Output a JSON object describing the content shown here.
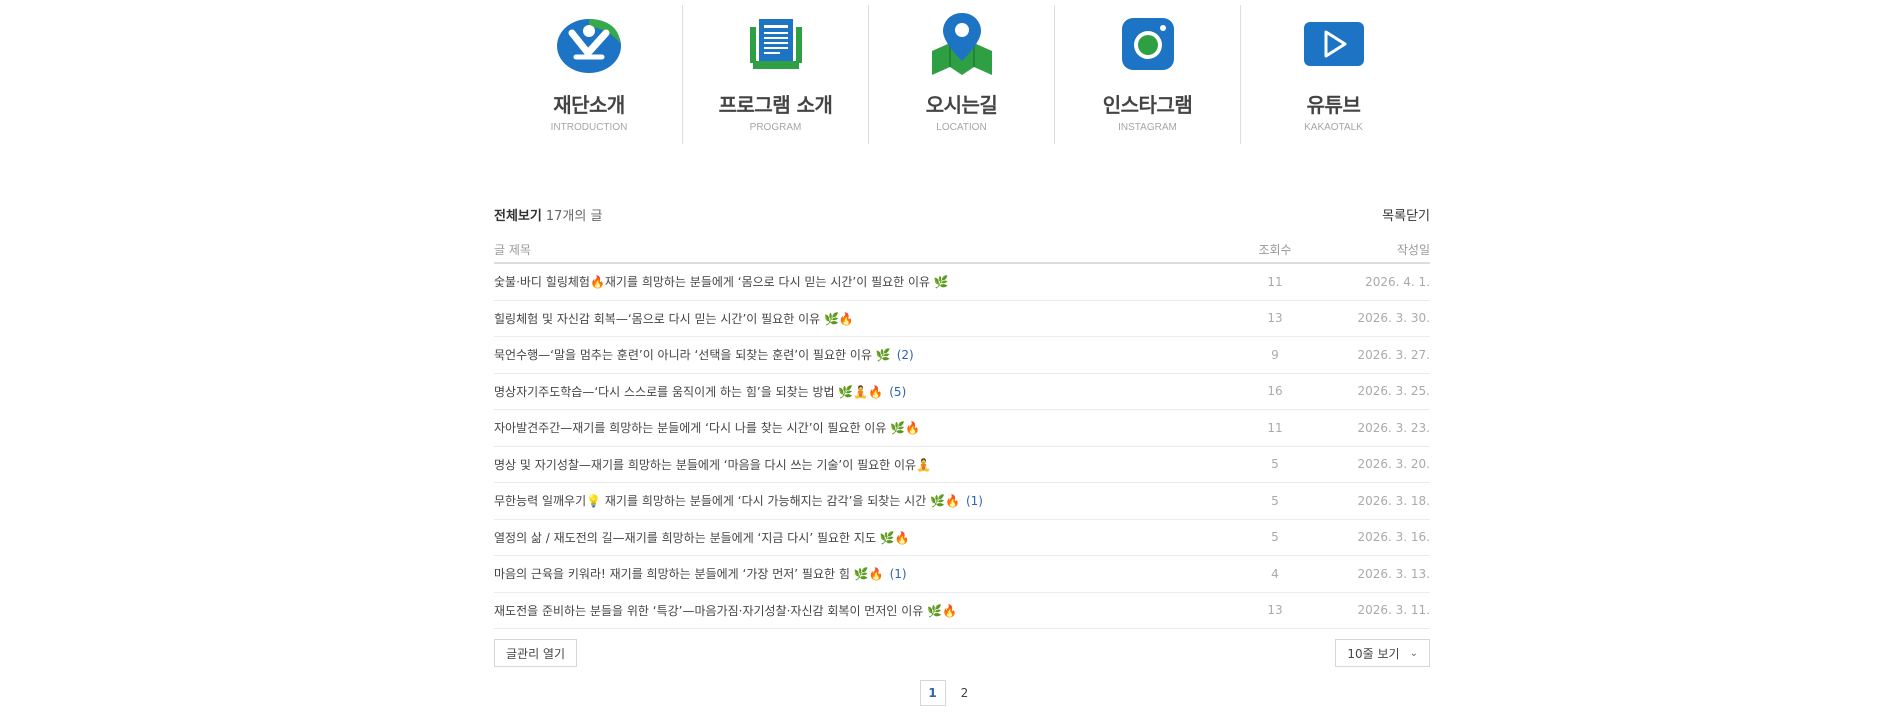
{
  "menu": [
    {
      "title": "재단소개",
      "sub": "INTRODUCTION",
      "icon": "introduction-icon"
    },
    {
      "title": "프로그램 소개",
      "sub": "PROGRAM",
      "icon": "document-icon"
    },
    {
      "title": "오시는길",
      "sub": "LOCATION",
      "icon": "map-pin-icon"
    },
    {
      "title": "인스타그램",
      "sub": "INSTAGRAM",
      "icon": "instagram-icon"
    },
    {
      "title": "유튜브",
      "sub": "KAKAOTALK",
      "icon": "play-icon"
    }
  ],
  "board": {
    "all_label": "전체보기",
    "count_label": "17개의 글",
    "close_label": "목록닫기",
    "columns": {
      "title": "글 제목",
      "views": "조회수",
      "date": "작성일"
    },
    "posts": [
      {
        "title": "숯불·바디 힐링체험🔥재기를 희망하는 분들에게 ‘몸으로 다시 믿는 시간’이 필요한 이유 🌿",
        "comments": "",
        "views": "11",
        "date": "2026. 4. 1."
      },
      {
        "title": "힐링체험 및 자신감 회복—‘몸으로 다시 믿는 시간’이 필요한 이유 🌿🔥",
        "comments": "",
        "views": "13",
        "date": "2026. 3. 30."
      },
      {
        "title": "묵언수행—‘말을 멈추는 훈련’이 아니라 ‘선택을 되찾는 훈련’이 필요한 이유 🌿",
        "comments": "(2)",
        "views": "9",
        "date": "2026. 3. 27."
      },
      {
        "title": "명상자기주도학습—‘다시 스스로를 움직이게 하는 힘’을 되찾는 방법 🌿🧘🔥",
        "comments": "(5)",
        "views": "16",
        "date": "2026. 3. 25."
      },
      {
        "title": "자아발견주간—재기를 희망하는 분들에게 ‘다시 나를 찾는 시간’이 필요한 이유 🌿🔥",
        "comments": "",
        "views": "11",
        "date": "2026. 3. 23."
      },
      {
        "title": "명상 및 자기성찰—재기를 희망하는 분들에게 ‘마음을 다시 쓰는 기술’이 필요한 이유🧘",
        "comments": "",
        "views": "5",
        "date": "2026. 3. 20."
      },
      {
        "title": "무한능력 일깨우기💡 재기를 희망하는 분들에게 ‘다시 가능해지는 감각’을 되찾는 시간 🌿🔥",
        "comments": "(1)",
        "views": "5",
        "date": "2026. 3. 18."
      },
      {
        "title": "열정의 삶 / 재도전의 길—재기를 희망하는 분들에게 ‘지금 다시’ 필요한 지도 🌿🔥",
        "comments": "",
        "views": "5",
        "date": "2026. 3. 16."
      },
      {
        "title": "마음의 근육을 키워라! 재기를 희망하는 분들에게 ‘가장 먼저’ 필요한 힘 🌿🔥",
        "comments": "(1)",
        "views": "4",
        "date": "2026. 3. 13."
      },
      {
        "title": "재도전을 준비하는 분들을 위한 ‘특강’—마음가짐·자기성찰·자신감 회복이 먼저인 이유 🌿🔥",
        "comments": "",
        "views": "13",
        "date": "2026. 3. 11."
      }
    ],
    "manage_label": "글관리 열기",
    "per_page_label": "10줄 보기"
  },
  "pager": {
    "pages": [
      "1",
      "2"
    ],
    "current": "1"
  },
  "colors": {
    "green": "#2ea043",
    "blue": "#1d74c4",
    "accent": "#2d64b3"
  }
}
